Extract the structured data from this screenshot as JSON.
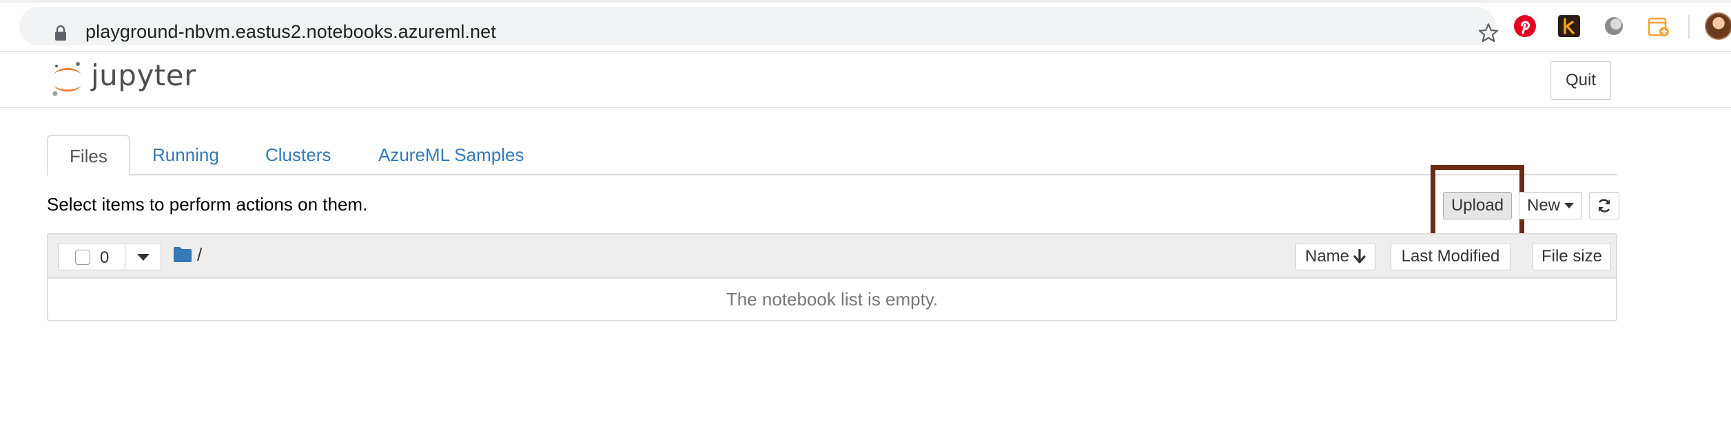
{
  "browser": {
    "url": "playground-nbvm.eastus2.notebooks.azureml.net",
    "icons": [
      "lock-icon",
      "star-icon",
      "pinterest-icon",
      "k-extension-icon",
      "circle-extension-icon",
      "calendar-extension-icon",
      "profile-avatar"
    ]
  },
  "header": {
    "logo_text": "jupyter",
    "quit_label": "Quit"
  },
  "tabs": [
    {
      "label": "Files",
      "active": true
    },
    {
      "label": "Running",
      "active": false
    },
    {
      "label": "Clusters",
      "active": false
    },
    {
      "label": "AzureML Samples",
      "active": false
    }
  ],
  "toolbar": {
    "hint": "Select items to perform actions on them.",
    "upload_label": "Upload",
    "new_label": "New",
    "refresh_icon": "refresh-icon"
  },
  "file_list": {
    "selected_count": "0",
    "breadcrumb_root": "/",
    "columns": {
      "name": "Name",
      "last_modified": "Last Modified",
      "file_size": "File size"
    },
    "empty_message": "The notebook list is empty."
  },
  "colors": {
    "link": "#337ab7",
    "highlight_box": "#6b2a16",
    "jupyter_orange": "#f37726"
  }
}
